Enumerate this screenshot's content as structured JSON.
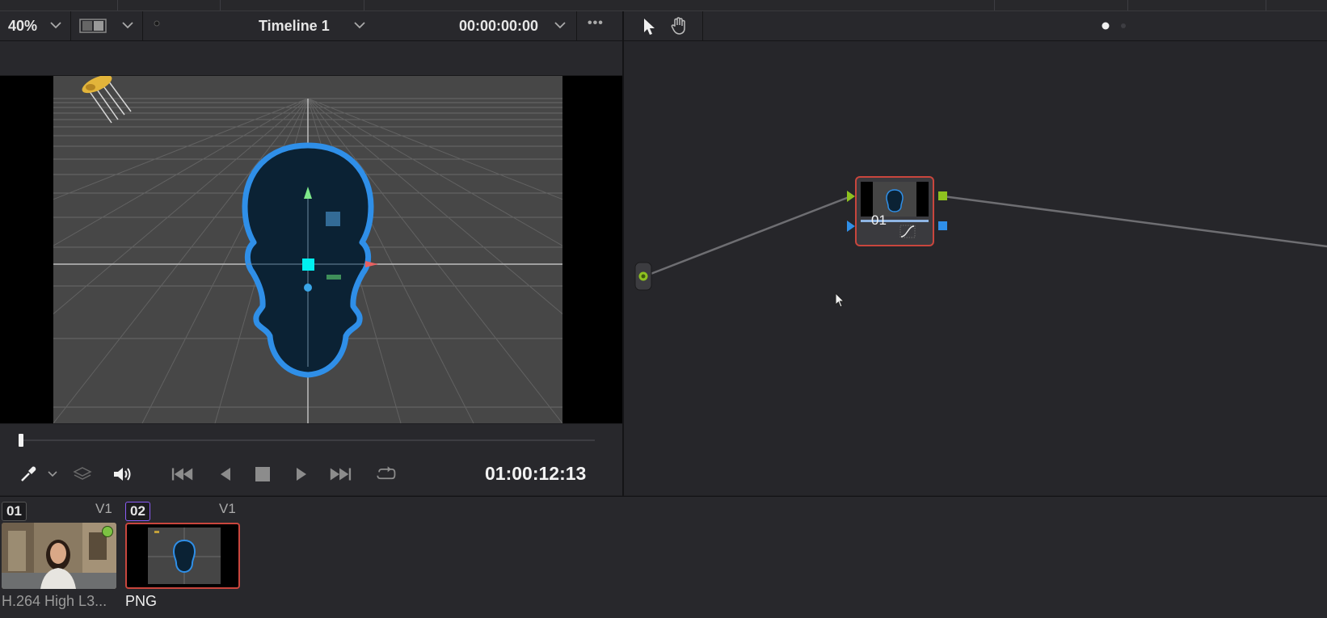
{
  "viewer": {
    "zoom": "40%",
    "timeline": "Timeline 1",
    "header_timecode": "00:00:00:00",
    "more": "•••",
    "playback_timecode": "01:00:12:13"
  },
  "node_editor": {
    "node": {
      "label": "01"
    },
    "page_indicator": {
      "active": 0,
      "count": 2
    }
  },
  "clips": [
    {
      "number": "01",
      "track": "V1",
      "label": "H.264 High L3...",
      "selected": false
    },
    {
      "number": "02",
      "track": "V1",
      "label": "PNG",
      "selected": true
    }
  ],
  "colors": {
    "accent_red": "#c9463d",
    "mask_blue": "#2f8fe8",
    "node_green": "#8ec21f",
    "node_blue": "#2f8fe8",
    "clip02_border": "#8b5cf6"
  }
}
